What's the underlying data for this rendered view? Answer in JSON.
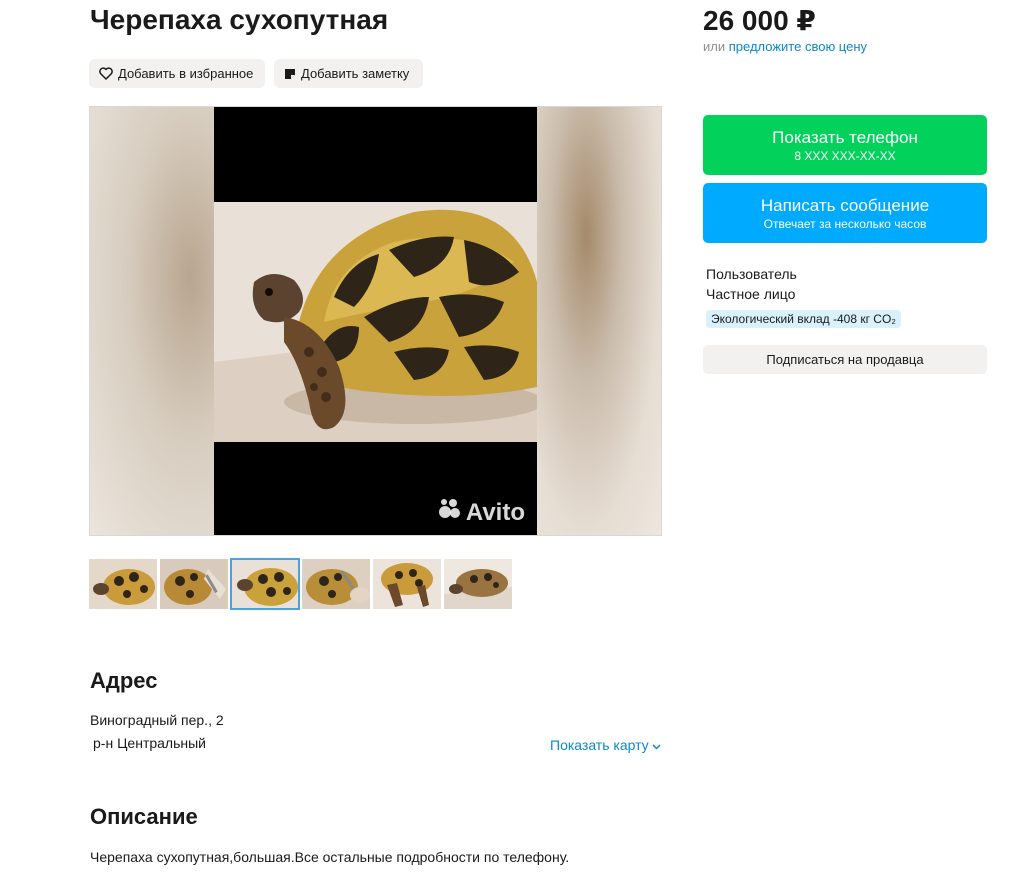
{
  "listing": {
    "title": "Черепаха сухопутная",
    "price": "26 000 ₽",
    "offer_prefix": "или ",
    "offer_link": "предложите свою цену"
  },
  "actions": {
    "favorite_label": "Добавить в избранное",
    "note_label": "Добавить заметку"
  },
  "gallery": {
    "watermark": "Avito",
    "thumbnail_count": 6,
    "active_thumbnail": 3
  },
  "contact": {
    "phone_label": "Показать телефон",
    "phone_masked": "8 XXX XXX-XX-XX",
    "message_label": "Написать сообщение",
    "message_sub": "Отвечает за несколько часов"
  },
  "seller": {
    "name": "Пользователь",
    "type": "Частное лицо",
    "eco_badge": "Экологический вклад -408 кг CO₂",
    "subscribe_label": "Подписаться на продавца"
  },
  "address": {
    "heading": "Адрес",
    "street": "Виноградный пер., 2",
    "district": "р-н Центральный",
    "show_map": "Показать карту"
  },
  "description": {
    "heading": "Описание",
    "text": "Черепаха сухопутная,большая.Все остальные подробности по телефону."
  },
  "colors": {
    "phone_button": "#02d15c",
    "message_button": "#00aaff",
    "link": "#0a88cc",
    "eco_badge_bg": "#d9f1fd"
  },
  "icons": {
    "favorite": "heart-icon",
    "note": "note-icon",
    "watermark": "avito-logo-icon",
    "map": "chevron-down-icon"
  }
}
